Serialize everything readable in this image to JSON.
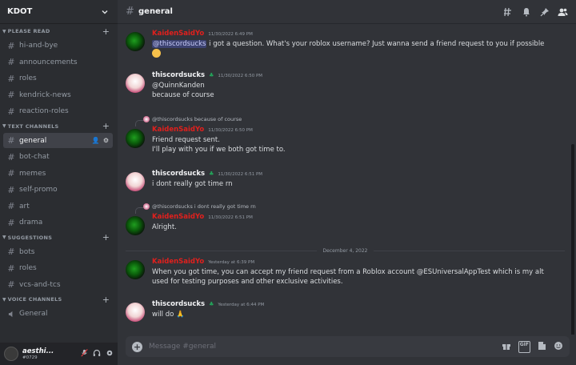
{
  "server": {
    "name": "KDOT"
  },
  "categories": {
    "please_read": "PLEASE READ",
    "text_channels": "TEXT CHANNELS",
    "suggestions": "SUGGESTIONS",
    "voice_channels": "VOICE CHANNELS"
  },
  "channels": {
    "please_read": [
      "hi-and-bye",
      "announcements",
      "roles",
      "kendrick-news",
      "reaction-roles"
    ],
    "text": [
      "general",
      "bot-chat",
      "memes",
      "self-promo",
      "art",
      "drama"
    ],
    "suggestions": [
      "bots",
      "roles",
      "vcs-and-tcs"
    ],
    "voice": [
      "General"
    ]
  },
  "active_channel": "general",
  "user": {
    "name": "aesthi...",
    "tag": "#0729"
  },
  "topbar": {
    "channel": "general"
  },
  "messages": [
    {
      "author": "KaidenSaidYo",
      "ts": "11/30/2022 6:49 PM",
      "lines": [
        "@thiscordsucks i got a question. What's your roblox username? Just wanna send a friend request to you if possible"
      ],
      "mention": "@thiscordsucks",
      "rest": " i got a question. What's your roblox username? Just wanna send a friend request to you if possible"
    },
    {
      "author": "thiscordsucks",
      "ts": "11/30/2022 6:50 PM",
      "lines": [
        "@QuinnKanden",
        "because of course"
      ]
    },
    {
      "reply": "@thiscordsucks because of course",
      "author": "KaidenSaidYo",
      "ts": "11/30/2022 6:50 PM",
      "lines": [
        "Friend request sent.",
        "I'll play with you if we both got time to."
      ]
    },
    {
      "author": "thiscordsucks",
      "ts": "11/30/2022 6:51 PM",
      "lines": [
        "i dont really got time rn"
      ]
    },
    {
      "reply": "@thiscordsucks i dont really got time rn",
      "author": "KaidenSaidYo",
      "ts": "11/30/2022 6:51 PM",
      "lines": [
        "Alright."
      ]
    },
    {
      "author": "KaidenSaidYo",
      "ts": "Yesterday at 6:39 PM",
      "lines": [
        "When you got time, you can accept my friend request from a Roblox account @ESUniversalAppTest which is my alt",
        "used for testing purposes and other exclusive activities."
      ]
    },
    {
      "author": "thiscordsucks",
      "ts": "Yesterday at 6:44 PM",
      "lines": [
        "will do"
      ]
    }
  ],
  "date_divider": "December 4, 2022",
  "composer": {
    "placeholder": "Message #general"
  },
  "colors": {
    "accent_red": "#e0201d",
    "active_bg": "#404249",
    "mention_bg": "#3c4270"
  },
  "icons": [
    "threads-icon",
    "bell-icon",
    "pin-icon",
    "members-icon",
    "gift-icon",
    "gif-icon",
    "sticker-icon",
    "emoji-icon",
    "mic-icon",
    "headphones-icon",
    "settings-icon"
  ]
}
